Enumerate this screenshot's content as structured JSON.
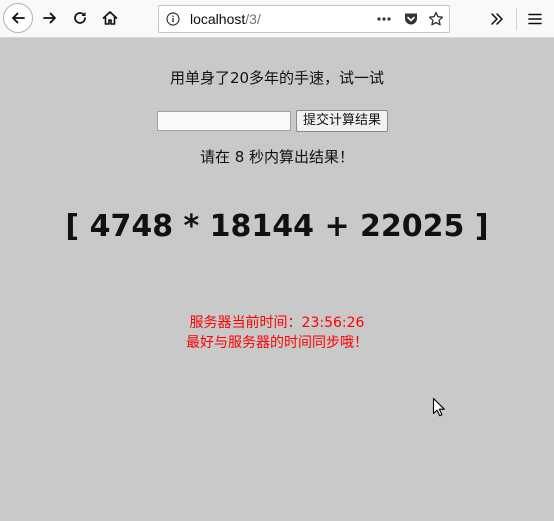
{
  "browser": {
    "url_host": "localhost",
    "url_path": "/3/"
  },
  "page": {
    "heading": "用单身了20多年的手速，试一试",
    "answer_input": {
      "value": "",
      "placeholder": ""
    },
    "submit_label": "提交计算结果",
    "countdown": "请在 8 秒内算出结果！",
    "formula": "[ 4748 * 18144 + 22025 ]",
    "server_time": "服务器当前时间：23:56:26",
    "sync_hint": "最好与服务器的时间同步哦！"
  },
  "colors": {
    "page_background": "#c9c9c9",
    "warning_text": "#ff0000"
  },
  "icons": [
    "back-arrow-icon",
    "forward-arrow-icon",
    "reload-icon",
    "home-icon",
    "info-icon",
    "more-dots-icon",
    "pocket-icon",
    "bookmark-star-icon",
    "overflow-chevron-icon",
    "hamburger-menu-icon",
    "mouse-cursor-icon"
  ]
}
